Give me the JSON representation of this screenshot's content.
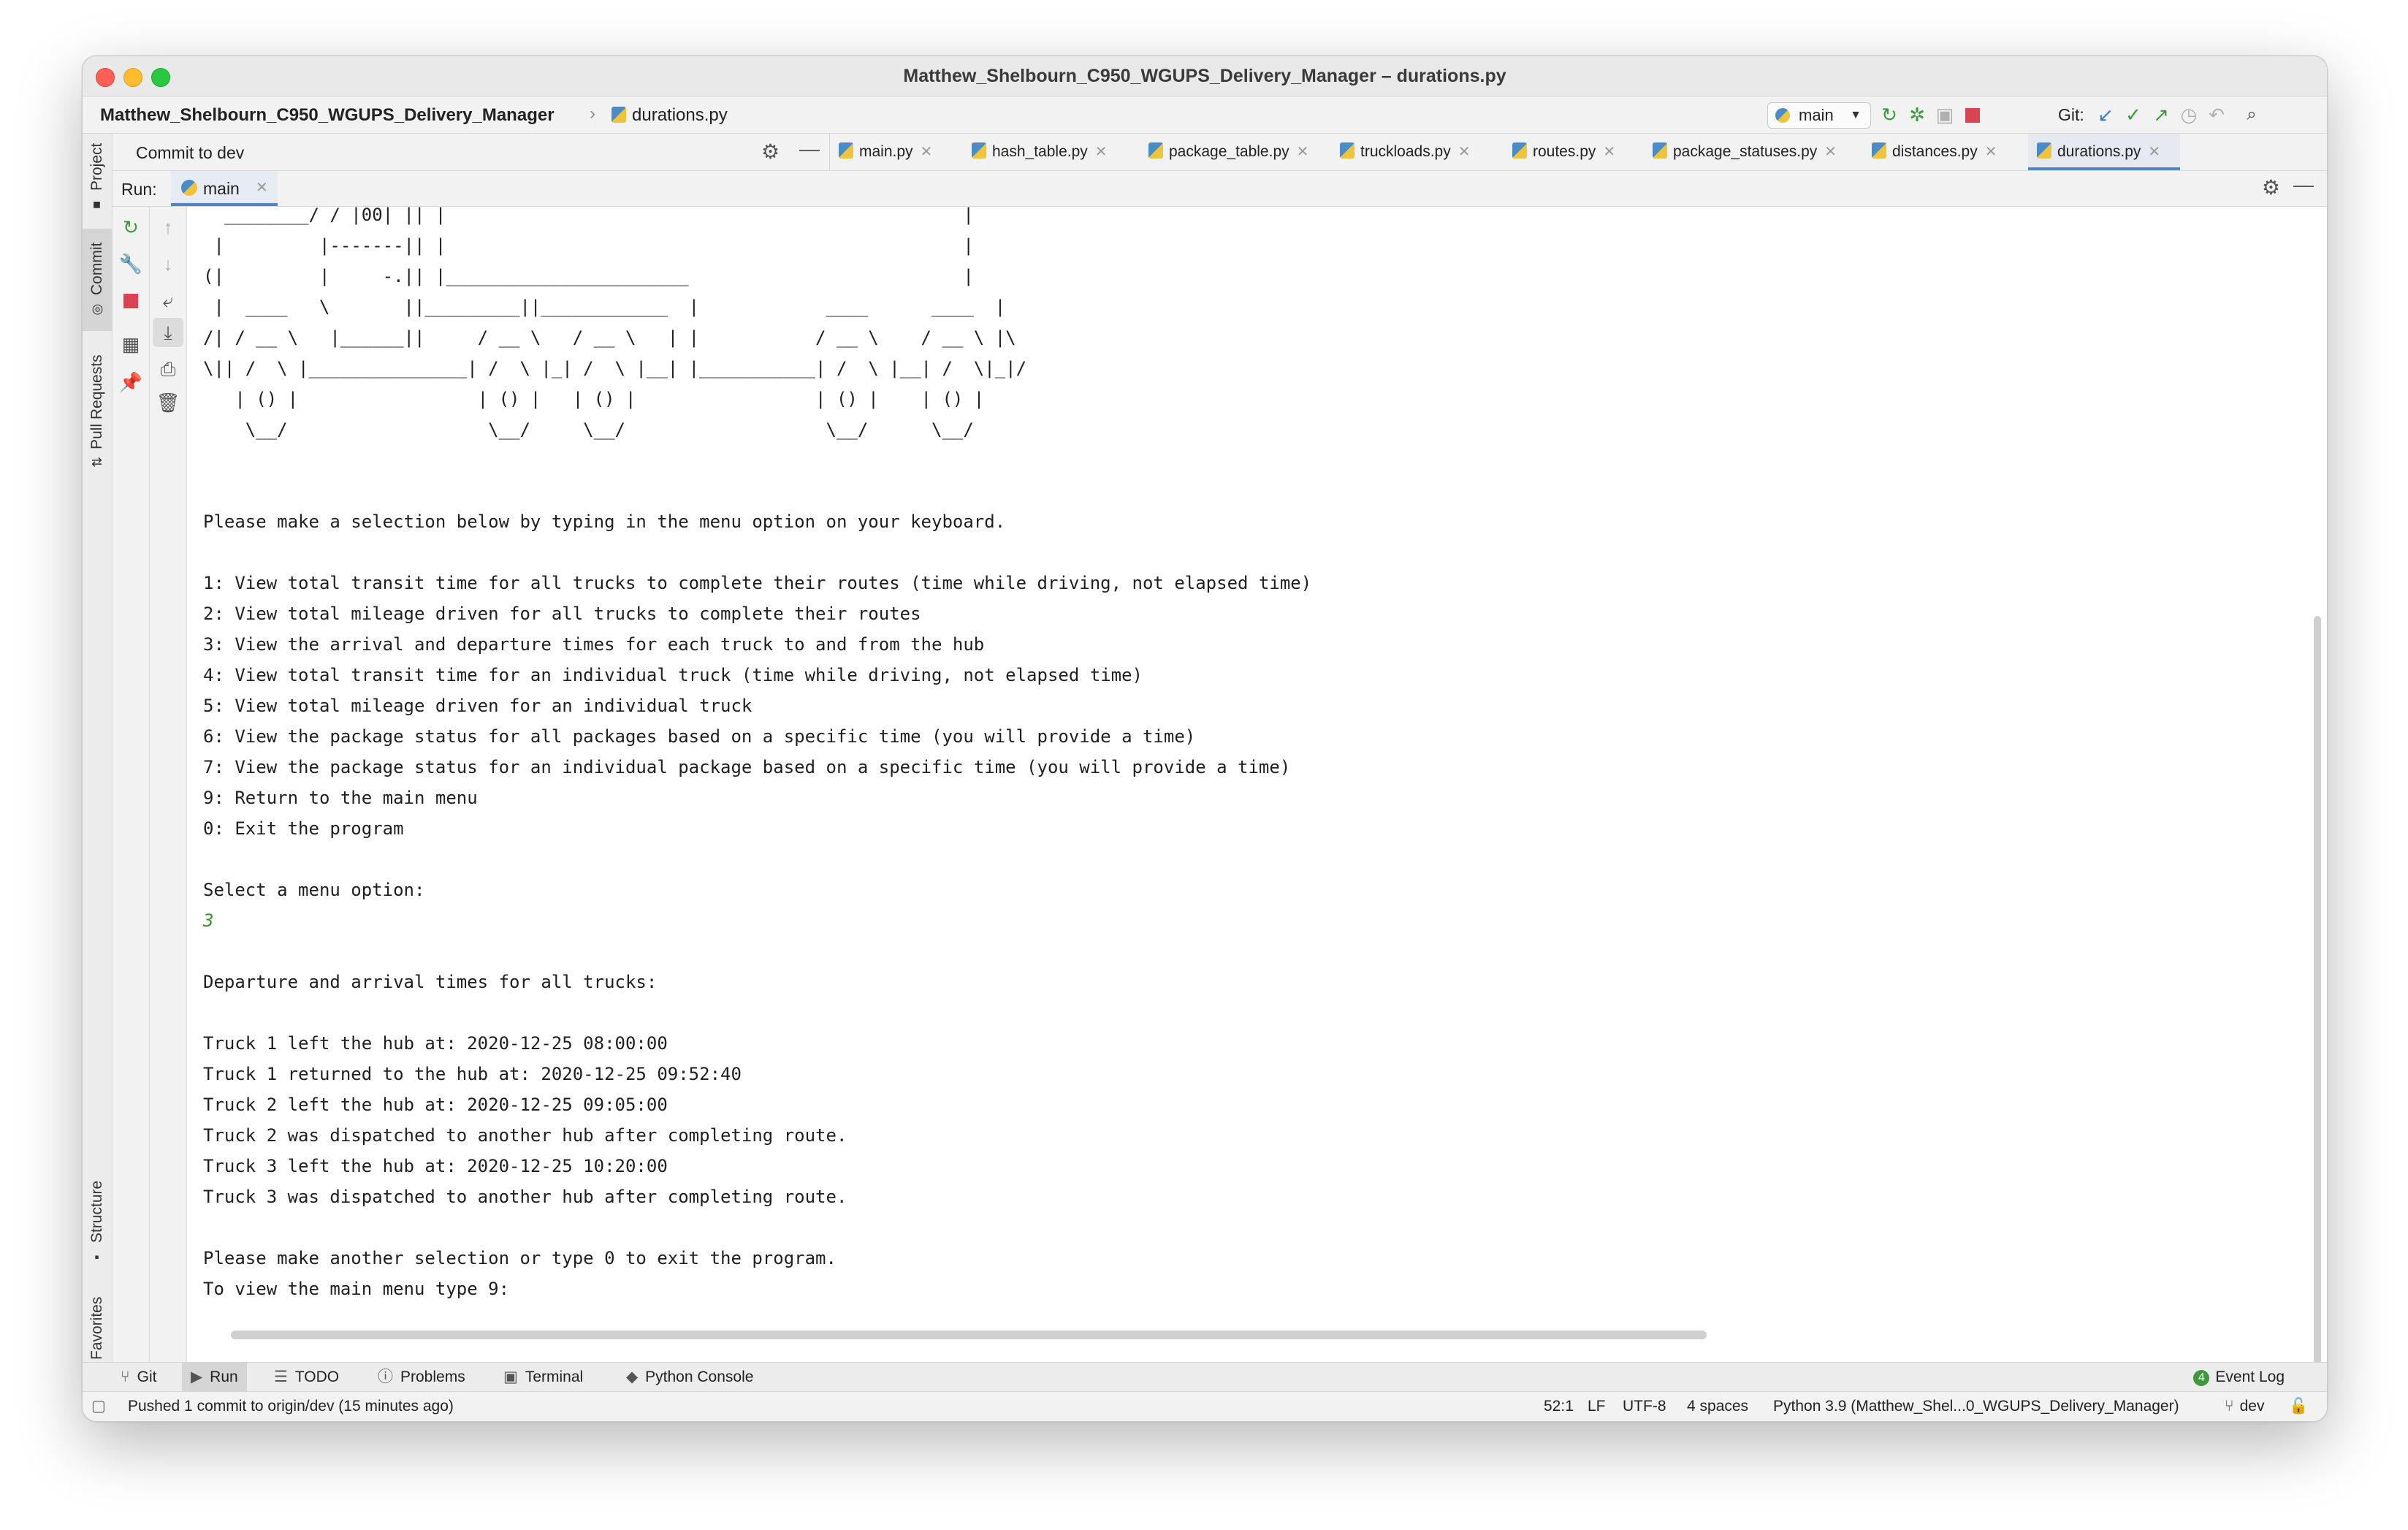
{
  "window": {
    "title": "Matthew_Shelbourn_C950_WGUPS_Delivery_Manager – durations.py"
  },
  "navbar": {
    "project": "Matthew_Shelbourn_C950_WGUPS_Delivery_Manager",
    "file": "durations.py",
    "run_config": "main",
    "git_label": "Git:"
  },
  "left_strip": {
    "project": "Project",
    "commit": "Commit",
    "pull_requests": "Pull Requests",
    "structure": "Structure",
    "favorites": "Favorites"
  },
  "commit_panel": {
    "title": "Commit to dev"
  },
  "editor_tabs": [
    "main.py",
    "hash_table.py",
    "package_table.py",
    "truckloads.py",
    "routes.py",
    "package_statuses.py",
    "distances.py",
    "durations.py"
  ],
  "run_panel": {
    "label": "Run:",
    "tab": "main"
  },
  "console": {
    "ascii_art": [
      "  ________/ / |00| || |                                                 |",
      " |         |-------|| |                                                 |",
      "(|         |     -.|| |_______________________                          |",
      " |  ____   \\       ||_________||____________  |            ____      ____  |",
      "/| / __ \\   |______||     / __ \\   / __ \\   | |           / __ \\    / __ \\ |\\",
      "\\|| /  \\ |_______________| /  \\ |_| /  \\ |__| |___________| /  \\ |__| /  \\|_|/",
      "   | () |                 | () |   | () |                 | () |    | () |",
      "    \\__/                   \\__/     \\__/                   \\__/      \\__/"
    ],
    "prompt": "Please make a selection below by typing in the menu option on your keyboard.",
    "menu": [
      "1: View total transit time for all trucks to complete their routes (time while driving, not elapsed time)",
      "2: View total mileage driven for all trucks to complete their routes",
      "3: View the arrival and departure times for each truck to and from the hub",
      "4: View total transit time for an individual truck (time while driving, not elapsed time)",
      "5: View total mileage driven for an individual truck",
      "6: View the package status for all packages based on a specific time (you will provide a time)",
      "7: View the package status for an individual package based on a specific time (you will provide a time)",
      "9: Return to the main menu",
      "0: Exit the program"
    ],
    "select_prompt": "Select a menu option:",
    "user_input": "3",
    "result_header": "Departure and arrival times for all trucks:",
    "results": [
      "Truck 1 left the hub at: 2020-12-25 08:00:00",
      "Truck 1 returned to the hub at: 2020-12-25 09:52:40",
      "Truck 2 left the hub at: 2020-12-25 09:05:00",
      "Truck 2 was dispatched to another hub after completing route.",
      "Truck 3 left the hub at: 2020-12-25 10:20:00",
      "Truck 3 was dispatched to another hub after completing route."
    ],
    "footer": [
      "Please make another selection or type 0 to exit the program.",
      "To view the main menu type 9:"
    ]
  },
  "bottom_tools": [
    "Git",
    "Run",
    "TODO",
    "Problems",
    "Terminal",
    "Python Console"
  ],
  "event_log": {
    "count": "4",
    "label": "Event Log"
  },
  "status": {
    "message": "Pushed 1 commit to origin/dev (15 minutes ago)",
    "position": "52:1",
    "line_sep": "LF",
    "encoding": "UTF-8",
    "indent": "4 spaces",
    "interpreter": "Python 3.9 (Matthew_Shel...0_WGUPS_Delivery_Manager)",
    "branch": "dev"
  },
  "colors": {
    "accent": "#4a88c7",
    "console_input": "#3f8c2b"
  }
}
